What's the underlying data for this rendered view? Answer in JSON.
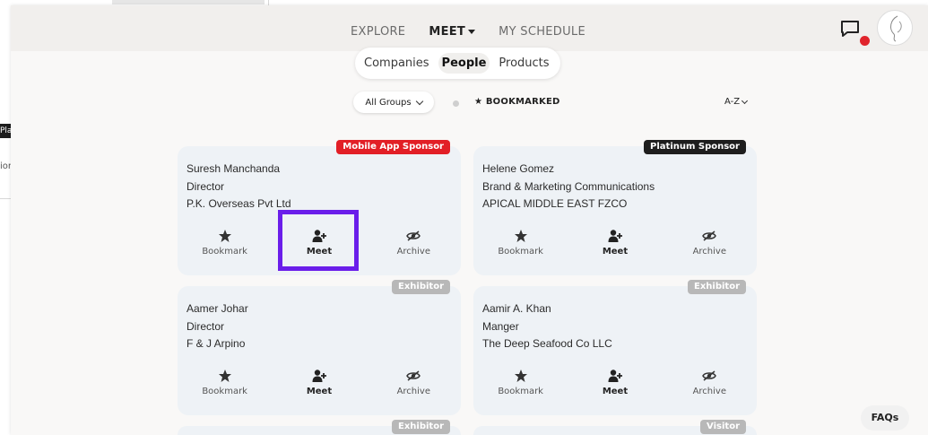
{
  "background_window": {
    "tag_text": "Pla",
    "side_text": "ion"
  },
  "nav": {
    "explore": "EXPLORE",
    "meet": "MEET",
    "schedule": "MY SCHEDULE"
  },
  "tabs": {
    "companies": "Companies",
    "people": "People",
    "products": "Products"
  },
  "filters": {
    "groups": "All Groups",
    "bookmarked": "★ BOOKMARKED",
    "sort": "A-Z"
  },
  "actions": {
    "bookmark": "Bookmark",
    "meet": "Meet",
    "archive": "Archive"
  },
  "cards": [
    {
      "badge": "Mobile App Sponsor",
      "name": "Suresh Manchanda",
      "title": "Director",
      "company": "P.K. Overseas Pvt Ltd"
    },
    {
      "badge": "Platinum Sponsor",
      "name": "Helene Gomez",
      "title": "Brand & Marketing Communications",
      "company": "APICAL MIDDLE EAST FZCO"
    },
    {
      "badge": "Exhibitor",
      "name": "Aamer Johar",
      "title": "Director",
      "company": "F & J Arpino"
    },
    {
      "badge": "Exhibitor",
      "name": "Aamir A. Khan",
      "title": "Manger",
      "company": "The Deep Seafood Co LLC"
    },
    {
      "badge": "Exhibitor"
    },
    {
      "badge": "Visitor"
    }
  ],
  "faq": "FAQs",
  "colors": {
    "accent": "#e21f26",
    "highlight": "#6a1eea",
    "card_bg": "#eef2f6"
  }
}
